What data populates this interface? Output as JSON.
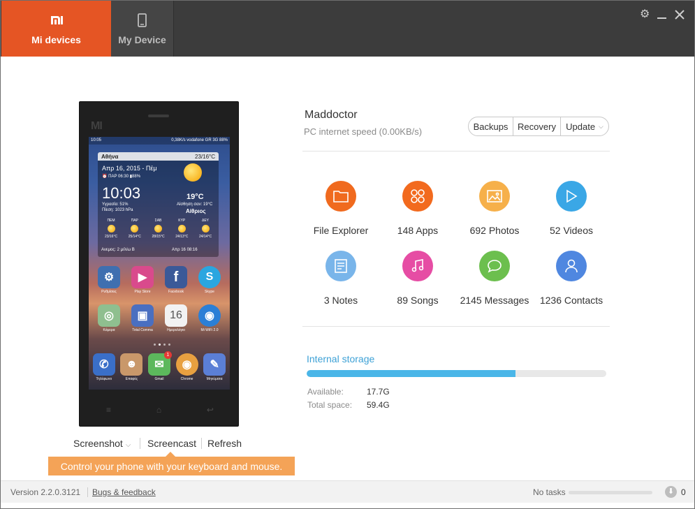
{
  "tabs": [
    {
      "label": "Mi devices",
      "icon": "mi-logo-icon",
      "active": true
    },
    {
      "label": "My Device",
      "icon": "phone-icon",
      "active": false
    }
  ],
  "window_controls": {
    "settings": "gear-icon",
    "minimize": "minimize-icon",
    "close": "close-icon"
  },
  "phone": {
    "logo": "MI",
    "status_left": "10:05",
    "status_right": "0,38K/s  vodafone GR 3G  88%",
    "weather": {
      "location": "Αθήνα",
      "temp_range": "23/16°C",
      "date": "Απρ 16, 2015 - Πέμ",
      "alarm": "ΠΑΡ 06:30",
      "battery": "88%",
      "time": "10:03",
      "humidity": "Υγρασία: 51%",
      "pressure": "Πίεση: 1023 hPa",
      "temp": "19°C",
      "feels_like": "Αίσθηση σαν: 19°C",
      "condition": "Αίθριος",
      "days": [
        {
          "name": "ΠΕΜ",
          "range": "23/16°C"
        },
        {
          "name": "ΠΑΡ",
          "range": "25/14°C"
        },
        {
          "name": "ΣΑΒ",
          "range": "28/15°C"
        },
        {
          "name": "ΚΥΡ",
          "range": "24/13°C"
        },
        {
          "name": "ΔΕΥ",
          "range": "24/14°C"
        }
      ],
      "wind": "Ανεμος: 2 μ/λ/ω Β",
      "updated": "Απρ 16 08:16"
    },
    "apps_row1": [
      {
        "label": "Ρυθμίσεις",
        "icon": "settings-app-icon",
        "color": "#3f6fb0",
        "glyph": "⚙"
      },
      {
        "label": "Play Store",
        "icon": "play-store-icon",
        "color": "#d94a8c",
        "glyph": "▶"
      },
      {
        "label": "Facebook",
        "icon": "facebook-icon",
        "color": "#3b5998",
        "glyph": "f"
      },
      {
        "label": "Skype",
        "icon": "skype-icon",
        "color": "#2aa6e0",
        "glyph": "S"
      }
    ],
    "apps_row2": [
      {
        "label": "Κάμερα",
        "icon": "camera-app-icon",
        "color": "#8fbf8f",
        "glyph": "◎"
      },
      {
        "label": "Total Comma",
        "icon": "total-commander-icon",
        "color": "#4a6fc0",
        "glyph": "▣"
      },
      {
        "label": "Ημερολόγιο",
        "icon": "calendar-app-icon",
        "color": "#f2f2f2",
        "glyph": "16"
      },
      {
        "label": "Mi WiFi 2.0",
        "icon": "wifi-app-icon",
        "color": "#2b7fd6",
        "glyph": "◉"
      }
    ],
    "dock": [
      {
        "label": "Τηλέφωνο",
        "icon": "phone-app-icon",
        "color": "#3a6fc8",
        "glyph": "✆"
      },
      {
        "label": "Επαφές",
        "icon": "contacts-app-icon",
        "color": "#c9986a",
        "glyph": "☻"
      },
      {
        "label": "Gmail",
        "icon": "messages-app-icon",
        "color": "#5cb85c",
        "glyph": "✉"
      },
      {
        "label": "Chrome",
        "icon": "chrome-icon",
        "color": "#e8a040",
        "glyph": "◉"
      },
      {
        "label": "Μηνύματα",
        "icon": "messenger-icon",
        "color": "#5b7fd6",
        "glyph": "✎"
      }
    ],
    "badge": "1"
  },
  "phone_actions": {
    "screenshot": "Screenshot",
    "screencast": "Screencast",
    "refresh": "Refresh",
    "tooltip": "Control your phone with your keyboard and mouse."
  },
  "device": {
    "name": "Maddoctor",
    "speed": "PC internet speed (0.00KB/s)"
  },
  "buttons": {
    "backups": "Backups",
    "recovery": "Recovery",
    "update": "Update"
  },
  "features": [
    {
      "label": "File Explorer",
      "icon": "folder-icon",
      "color": "#f06a1e"
    },
    {
      "label": "148 Apps",
      "icon": "apps-grid-icon",
      "color": "#f26a1e"
    },
    {
      "label": "692 Photos",
      "icon": "photo-icon",
      "color": "#f6b04a"
    },
    {
      "label": "52 Videos",
      "icon": "play-icon",
      "color": "#3aa7e6"
    },
    {
      "label": "3 Notes",
      "icon": "notes-icon",
      "color": "#79b5ea"
    },
    {
      "label": "89 Songs",
      "icon": "music-icon",
      "color": "#e64da4"
    },
    {
      "label": "2145 Messages",
      "icon": "message-icon",
      "color": "#6cbf4e"
    },
    {
      "label": "1236 Contacts",
      "icon": "contact-icon",
      "color": "#4f87e0"
    }
  ],
  "storage": {
    "title": "Internal storage",
    "used_fraction": 0.698,
    "available_label": "Available:",
    "available": "17.7G",
    "total_label": "Total space:",
    "total": "59.4G"
  },
  "footer": {
    "version": "Version 2.2.0.3121",
    "bugs": "Bugs & feedback",
    "tasks": "No tasks",
    "downloads": "0"
  }
}
